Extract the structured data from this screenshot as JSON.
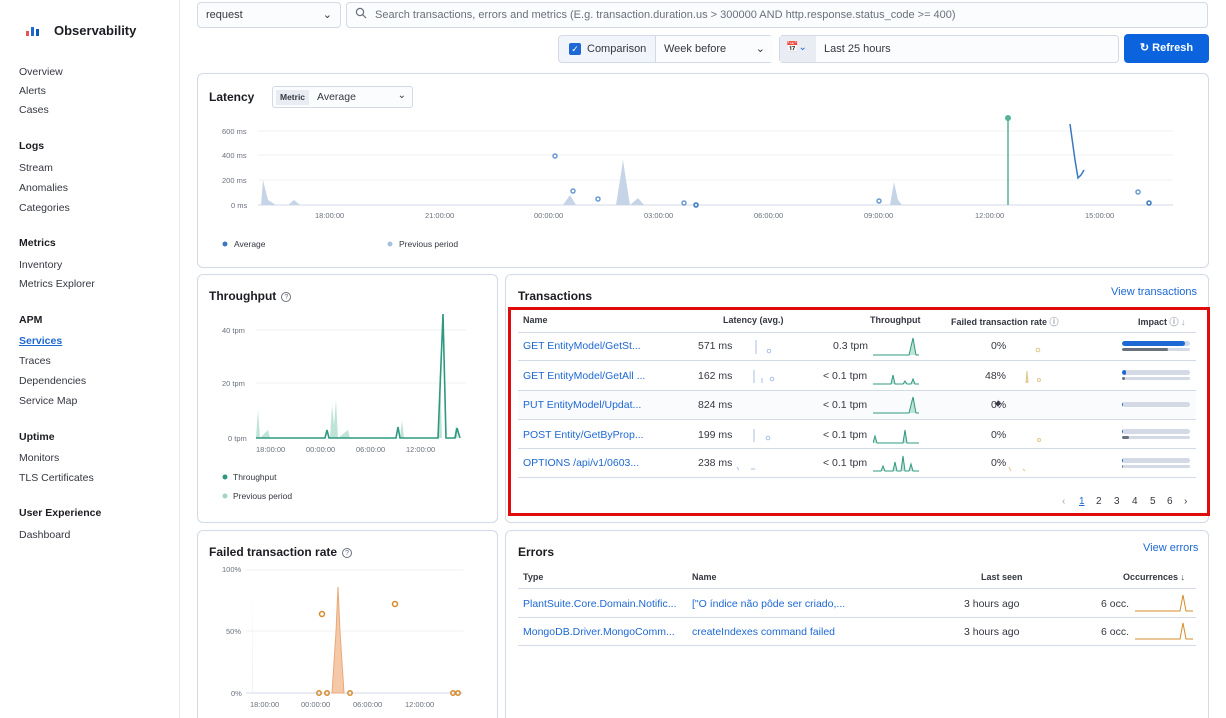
{
  "app": {
    "title": "Observability"
  },
  "sidebar": {
    "top": [
      "Overview",
      "Alerts",
      "Cases"
    ],
    "sections": [
      {
        "heading": "Logs",
        "items": [
          "Stream",
          "Anomalies",
          "Categories"
        ]
      },
      {
        "heading": "Metrics",
        "items": [
          "Inventory",
          "Metrics Explorer"
        ]
      },
      {
        "heading": "APM",
        "items": [
          "Services",
          "Traces",
          "Dependencies",
          "Service Map"
        ]
      },
      {
        "heading": "Uptime",
        "items": [
          "Monitors",
          "TLS Certificates"
        ]
      },
      {
        "heading": "User Experience",
        "items": [
          "Dashboard"
        ]
      }
    ],
    "active": "Services"
  },
  "toolbar": {
    "type_value": "request",
    "search_placeholder": "Search transactions, errors and metrics (E.g. transaction.duration.us > 300000 AND http.response.status_code >= 400)",
    "comparison_label": "Comparison",
    "comparison_checked": true,
    "comparison_value": "Week before",
    "date_value": "Last 25 hours",
    "refresh_label": "Refresh"
  },
  "latency": {
    "title": "Latency",
    "metric_tag": "Metric",
    "metric_value": "Average",
    "y_ticks": [
      "600 ms",
      "400 ms",
      "200 ms",
      "0 ms"
    ],
    "x_ticks": [
      "18:00:00",
      "21:00:00",
      "00:00:00",
      "03:00:00",
      "06:00:00",
      "09:00:00",
      "12:00:00",
      "15:00:00"
    ],
    "legend": [
      "Average",
      "Previous period"
    ]
  },
  "throughput": {
    "title": "Throughput",
    "y_ticks": [
      "40 tpm",
      "20 tpm",
      "0 tpm"
    ],
    "x_ticks": [
      "18:00:00",
      "00:00:00",
      "06:00:00",
      "12:00:00"
    ],
    "legend": [
      "Throughput",
      "Previous period"
    ]
  },
  "transactions": {
    "title": "Transactions",
    "view_link": "View transactions",
    "columns": [
      "Name",
      "Latency (avg.)",
      "Throughput",
      "Failed transaction rate",
      "Impact"
    ],
    "rows": [
      {
        "name": "GET EntityModel/GetSt...",
        "latency": "571 ms",
        "throughput": "0.3 tpm",
        "failed": "0%",
        "impact": 0.92,
        "impact_prev": 0.68
      },
      {
        "name": "GET EntityModel/GetAll ...",
        "latency": "162 ms",
        "throughput": "< 0.1 tpm",
        "failed": "48%",
        "impact": 0.06,
        "impact_prev": 0.05
      },
      {
        "name": "PUT EntityModel/Updat...",
        "latency": "824 ms",
        "throughput": "< 0.1 tpm",
        "failed": "0%",
        "impact": 0.02,
        "impact_prev": 0
      },
      {
        "name": "POST Entity/GetByProp...",
        "latency": "199 ms",
        "throughput": "< 0.1 tpm",
        "failed": "0%",
        "impact": 0.01,
        "impact_prev": 0.1
      },
      {
        "name": "OPTIONS /api/v1/0603...",
        "latency": "238 ms",
        "throughput": "< 0.1 tpm",
        "failed": "0%",
        "impact": 0.01,
        "impact_prev": 0.01
      }
    ],
    "pages": [
      "1",
      "2",
      "3",
      "4",
      "5",
      "6"
    ],
    "current_page": "1"
  },
  "failed_rate": {
    "title": "Failed transaction rate",
    "y_ticks": [
      "100%",
      "50%",
      "0%"
    ],
    "x_ticks": [
      "18:00:00",
      "00:00:00",
      "06:00:00",
      "12:00:00"
    ]
  },
  "errors": {
    "title": "Errors",
    "view_link": "View errors",
    "columns": [
      "Type",
      "Name",
      "Last seen",
      "Occurrences"
    ],
    "rows": [
      {
        "type": "PlantSuite.Core.Domain.Notific...",
        "name": "[\"O índice não pôde ser criado,...",
        "last_seen": "3 hours ago",
        "occ": "6 occ."
      },
      {
        "type": "MongoDB.Driver.MongoComm...",
        "name": "createIndexes command failed",
        "last_seen": "3 hours ago",
        "occ": "6 occ."
      }
    ]
  },
  "colors": {
    "accent": "#1d68d3",
    "throughput": "#54b399",
    "errors": "#d6a35c",
    "highlight": "#e00b0b"
  }
}
